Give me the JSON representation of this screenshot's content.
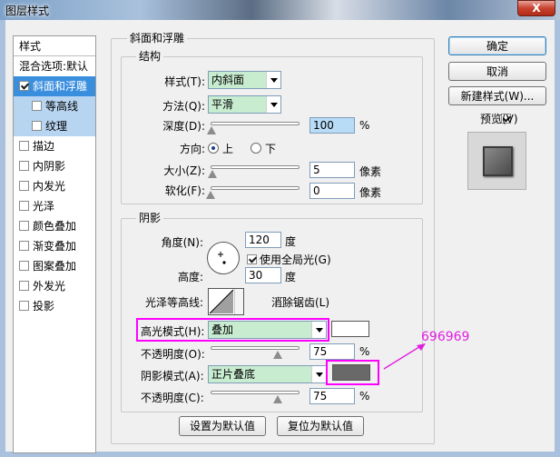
{
  "window": {
    "title": "图层样式",
    "close_label": "X"
  },
  "sidebar": {
    "header": "样式",
    "items": [
      {
        "label": "混合选项:默认",
        "type": "header"
      },
      {
        "label": "斜面和浮雕",
        "checked": true,
        "selected": true
      },
      {
        "label": "等高线",
        "checked": false,
        "sub": true
      },
      {
        "label": "纹理",
        "checked": false,
        "sub": true
      },
      {
        "label": "描边",
        "checked": false
      },
      {
        "label": "内阴影",
        "checked": false
      },
      {
        "label": "内发光",
        "checked": false
      },
      {
        "label": "光泽",
        "checked": false
      },
      {
        "label": "颜色叠加",
        "checked": false
      },
      {
        "label": "渐变叠加",
        "checked": false
      },
      {
        "label": "图案叠加",
        "checked": false
      },
      {
        "label": "外发光",
        "checked": false
      },
      {
        "label": "投影",
        "checked": false
      }
    ]
  },
  "panel": {
    "title": "斜面和浮雕",
    "structure": {
      "title": "结构",
      "style_label": "样式(T):",
      "style_value": "内斜面",
      "method_label": "方法(Q):",
      "method_value": "平滑",
      "depth_label": "深度(D):",
      "depth_value": "100",
      "depth_unit": "%",
      "depth_level": 0.01,
      "direction_label": "方向:",
      "direction_up": "上",
      "direction_down": "下",
      "size_label": "大小(Z):",
      "size_value": "5",
      "size_unit": "像素",
      "size_level": 0.02,
      "soften_label": "软化(F):",
      "soften_value": "0",
      "soften_unit": "像素",
      "soften_level": 0.0
    },
    "shading": {
      "title": "阴影",
      "angle_label": "角度(N):",
      "angle_value": "120",
      "angle_unit": "度",
      "global_light_label": "使用全局光(G)",
      "global_light_checked": true,
      "altitude_label": "高度:",
      "altitude_value": "30",
      "altitude_unit": "度",
      "gloss_label": "光泽等高线:",
      "antialias_label": "消除锯齿(L)",
      "antialias_checked": false,
      "highlight_mode_label": "高光模式(H):",
      "highlight_mode_value": "叠加",
      "highlight_color": "#ffffff",
      "highlight_opacity_label": "不透明度(O):",
      "highlight_opacity_value": "75",
      "highlight_opacity_level": 0.75,
      "shadow_mode_label": "阴影模式(A):",
      "shadow_mode_value": "正片叠底",
      "shadow_color": "#696969",
      "shadow_opacity_label": "不透明度(C):",
      "shadow_opacity_value": "75",
      "shadow_opacity_level": 0.75,
      "percent": "%"
    },
    "make_default": "设置为默认值",
    "reset_default": "复位为默认值"
  },
  "right": {
    "ok": "确定",
    "cancel": "取消",
    "new_style": "新建样式(W)...",
    "preview_label": "预览(V)",
    "preview_checked": true
  },
  "annotation": {
    "text": "696969",
    "color": "#e020e0"
  },
  "colors": {
    "selected": "#3a8ede",
    "field_green": "#c8ecd0",
    "highlight_box": "#ff00ff"
  }
}
